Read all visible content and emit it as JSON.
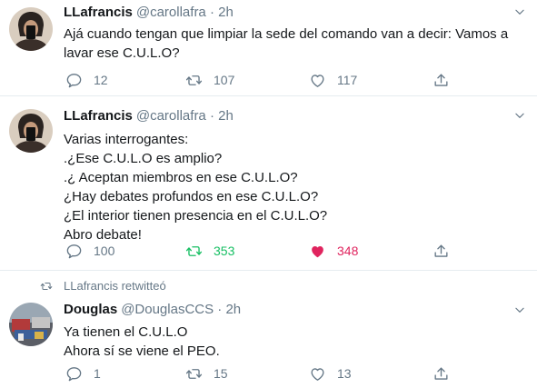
{
  "tweets": [
    {
      "name": "LLafrancis",
      "handle": "@carollafra",
      "dot": "·",
      "time": "2h",
      "text": "Ajá cuando tengan que limpiar la sede del comando van a decir: Vamos a\nlavar ese C.U.L.O?",
      "replies": "12",
      "retweets": "107",
      "likes": "117"
    },
    {
      "name": "LLafrancis",
      "handle": "@carollafra",
      "dot": "·",
      "time": "2h",
      "text": "Varias interrogantes:\n.¿Ese C.U.L.O  es amplio?\n.¿ Aceptan miembros en ese C.U.L.O?\n¿Hay debates profundos en ese C.U.L.O?\n¿El interior tienen presencia en el C.U.L.O?\nAbro debate!",
      "replies": "100",
      "retweets": "353",
      "likes": "348"
    },
    {
      "retweeted_by": "LLafrancis retwitteó",
      "name": "Douglas",
      "handle": "@DouglasCCS",
      "dot": "·",
      "time": "2h",
      "text": "Ya tienen el C.U.L.O\nAhora sí se viene el PEO.",
      "replies": "1",
      "retweets": "15",
      "likes": "13"
    }
  ],
  "colors": {
    "text": "#14171a",
    "muted": "#657786",
    "divider": "#e6ecf0",
    "retweet_active": "#17bf63",
    "like_active": "#e0245e"
  },
  "icons": [
    "reply-icon",
    "retweet-icon",
    "heart-icon",
    "share-icon",
    "chevron-down-icon"
  ]
}
